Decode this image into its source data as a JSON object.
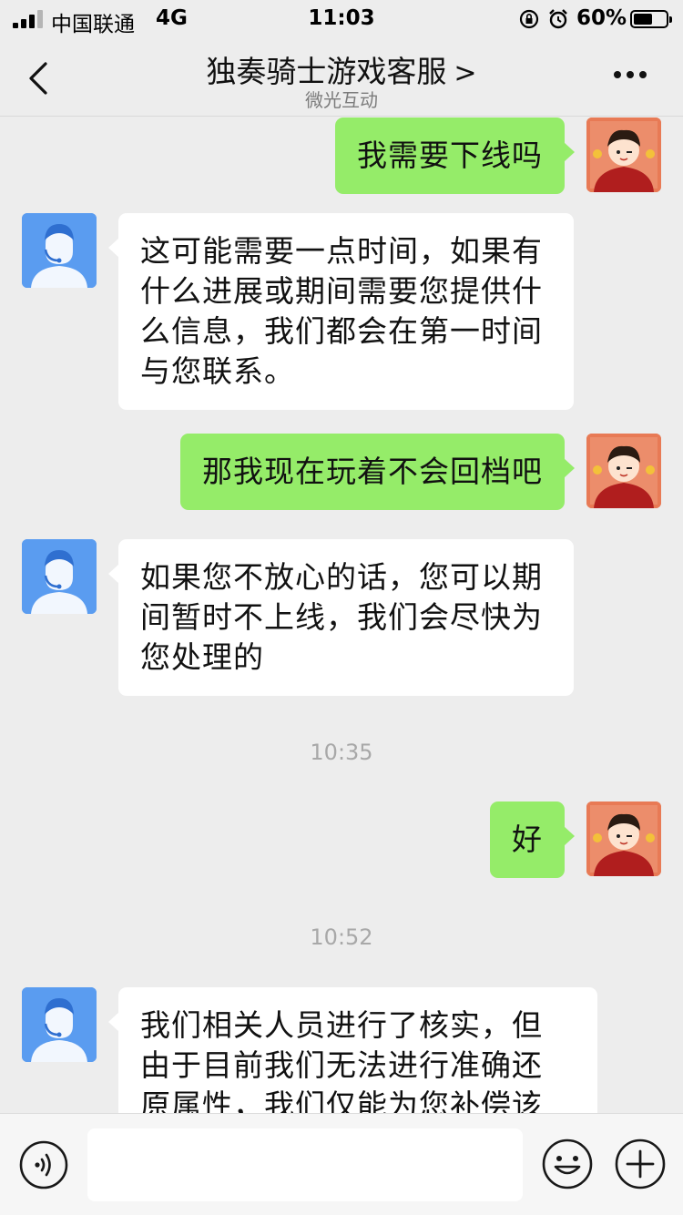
{
  "status_bar": {
    "carrier": "中国联通",
    "network": "4G",
    "time": "11:03",
    "battery_percent_label": "60%",
    "battery_level": 0.6
  },
  "nav": {
    "title": "独奏骑士游戏客服",
    "title_chevron": ">",
    "subtitle": "微光互动"
  },
  "messages": [
    {
      "sender": "user",
      "text": "我需要下线吗"
    },
    {
      "sender": "agent",
      "lines": [
        "这可能需要一点时间，如果有",
        "什么进展或期间需要您提供什",
        "么信息，我们都会在第一时间",
        "与您联系。"
      ]
    },
    {
      "sender": "user",
      "text": "那我现在玩着不会回档吧"
    },
    {
      "sender": "agent",
      "lines": [
        "如果您不放心的话，您可以期",
        "间暂时不上线，我们会尽快为",
        "您处理的"
      ]
    },
    {
      "type": "timestamp",
      "text": "10:35"
    },
    {
      "sender": "user",
      "text": "好"
    },
    {
      "type": "timestamp",
      "text": "10:52"
    },
    {
      "sender": "agent",
      "lines": [
        "我们相关人员进行了核实，但",
        "由于目前我们无法进行准确还",
        "原属性，我们仅能为您补偿该"
      ]
    }
  ],
  "input_bar": {
    "value": "",
    "icons": [
      "voice-icon",
      "emoji-icon",
      "plus-icon"
    ]
  },
  "colors": {
    "background": "#ededed",
    "user_bubble": "#95ec69",
    "agent_bubble": "#ffffff",
    "agent_avatar": "#5a9cf0",
    "user_avatar": "#e87a55"
  }
}
